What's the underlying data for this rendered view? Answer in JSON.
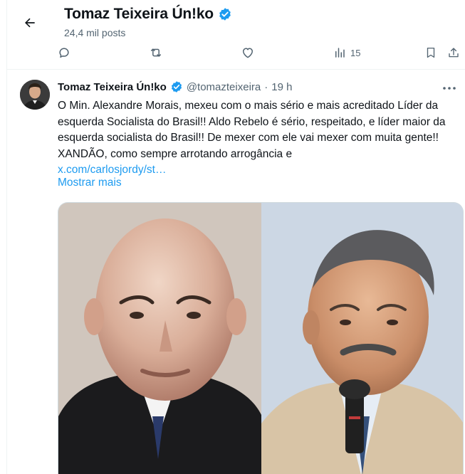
{
  "header": {
    "title": "Tomaz Teixeira Ún!ko",
    "posts": "24,4 mil posts"
  },
  "top_actions": {
    "views": "15"
  },
  "tweet": {
    "author_name": "Tomaz Teixeira Ún!ko",
    "handle": "@tomazteixeira",
    "separator": "·",
    "time": "19 h",
    "text": "O Min. Alexandre Morais, mexeu com o mais sério e mais acreditado Líder da esquerda Socialista do Brasil!! Aldo Rebelo é sério, respeitado, e líder maior da esquerda socialista do Brasil!! De mexer com ele vai mexer com muita gente!! XANDÃO, como sempre arrotando arrogância e",
    "link": "x.com/carlosjordy/st…",
    "show_more": "Mostrar mais"
  },
  "colors": {
    "accent": "#1d9bf0",
    "text_primary": "#0f1419",
    "text_secondary": "#536471",
    "border": "#eff3f4"
  },
  "icons": {
    "back": "arrow-left-icon",
    "verified": "verified-badge-icon",
    "reply": "reply-icon",
    "retweet": "retweet-icon",
    "like": "heart-icon",
    "views": "bar-chart-icon",
    "bookmark": "bookmark-icon",
    "share": "share-icon",
    "more": "more-dots-icon"
  }
}
